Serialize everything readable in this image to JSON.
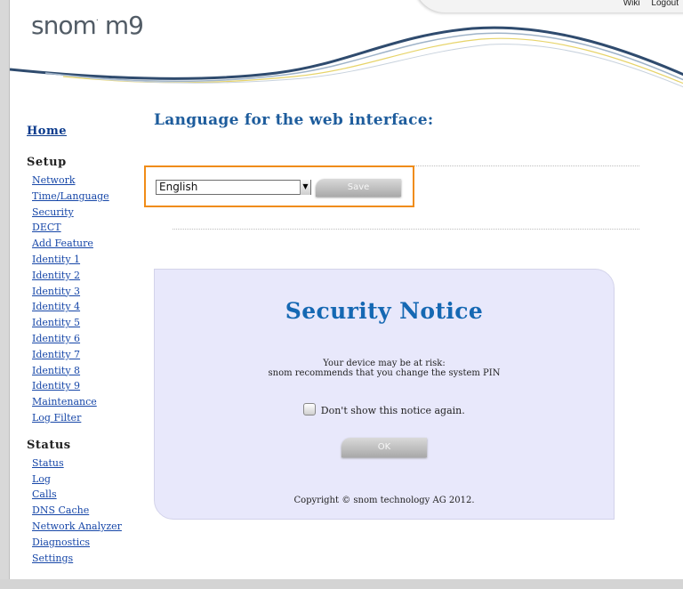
{
  "header": {
    "logo_main": "snom",
    "logo_model": "m9",
    "links": {
      "wiki": "Wiki",
      "logout": "Logout"
    }
  },
  "sidebar": {
    "home": "Home",
    "setup_heading": "Setup",
    "setup_items": [
      "Network",
      "Time/Language",
      "Security",
      "DECT",
      "Add Feature",
      "Identity 1",
      "Identity 2",
      "Identity 3",
      "Identity 4",
      "Identity 5",
      "Identity 6",
      "Identity 7",
      "Identity 8",
      "Identity 9",
      "Maintenance",
      "Log Filter"
    ],
    "status_heading": "Status",
    "status_items": [
      "Status",
      "Log",
      "Calls",
      "DNS Cache",
      "Network Analyzer",
      "Diagnostics",
      "Settings"
    ]
  },
  "language": {
    "heading": "Language for the web interface:",
    "selected": "English",
    "save_label": "Save"
  },
  "notice": {
    "title": "Security Notice",
    "line1": "Your device may be at risk:",
    "line2": "snom recommends that you change the system PIN",
    "checkbox_label": "Don't show this notice again.",
    "ok_label": "OK",
    "copyright": "Copyright © snom technology AG 2012."
  },
  "colors": {
    "accent_orange": "#f08c17",
    "heading_blue": "#1d5c9c",
    "notice_bg": "#e8e8fb",
    "link": "#1747a8"
  }
}
